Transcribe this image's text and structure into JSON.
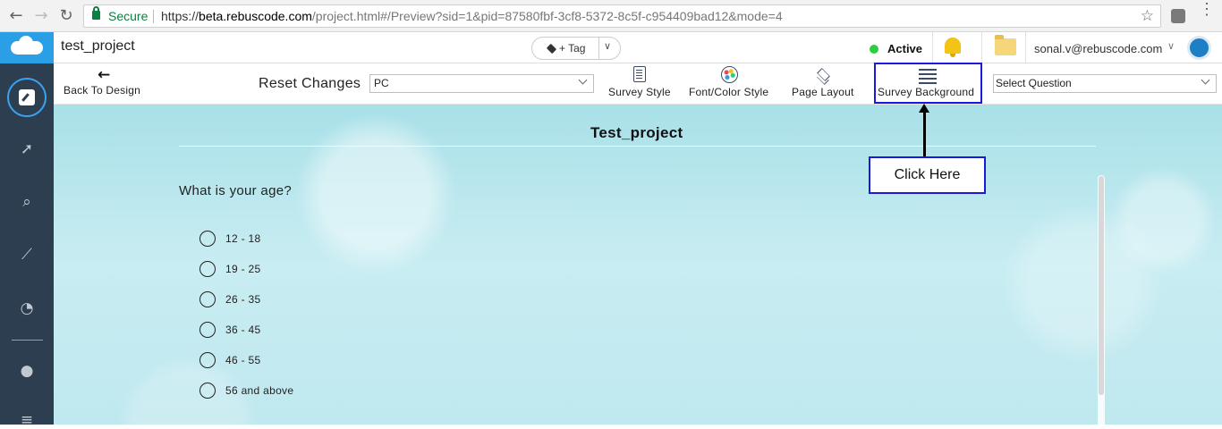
{
  "browser": {
    "back_icon": "arrow-left-icon",
    "forward_icon": "arrow-right-icon",
    "reload_icon": "reload-icon",
    "secure_label": "Secure",
    "url_scheme": "https://",
    "url_host": "beta.rebuscode.com",
    "url_path": "/project.html#/Preview?sid=1&pid=87580fbf-3cf8-5372-8c5f-c954409bad12&mode=4"
  },
  "header": {
    "project_name": "test_project",
    "tag_label": "+ Tag",
    "status": "Active",
    "status_color": "#2ecc40",
    "user_email": "sonal.v@rebuscode.com",
    "brand_color": "#2b9fe6"
  },
  "sidebar": {
    "items": [
      {
        "icon": "edit-icon",
        "active": true
      },
      {
        "icon": "rocket-icon"
      },
      {
        "icon": "search-icon"
      },
      {
        "icon": "chart-line-icon"
      },
      {
        "icon": "dashboard-icon"
      },
      {
        "icon": "user-icon"
      },
      {
        "icon": "database-icon"
      }
    ]
  },
  "toolbar": {
    "back_label": "Back To Design",
    "reset_label": "Reset Changes",
    "device_value": "PC",
    "survey_style_label": "Survey Style",
    "font_color_label": "Font/Color Style",
    "page_layout_label": "Page Layout",
    "survey_background_label": "Survey Background",
    "question_placeholder": "Select Question"
  },
  "survey": {
    "title": "Test_project",
    "question": "What is your age?",
    "options": [
      "12 - 18",
      "19 - 25",
      "26 - 35",
      "36 - 45",
      "46 - 55",
      "56 and above"
    ]
  },
  "annotation": {
    "callout_text": "Click Here",
    "highlight_color": "#1a1adb"
  }
}
